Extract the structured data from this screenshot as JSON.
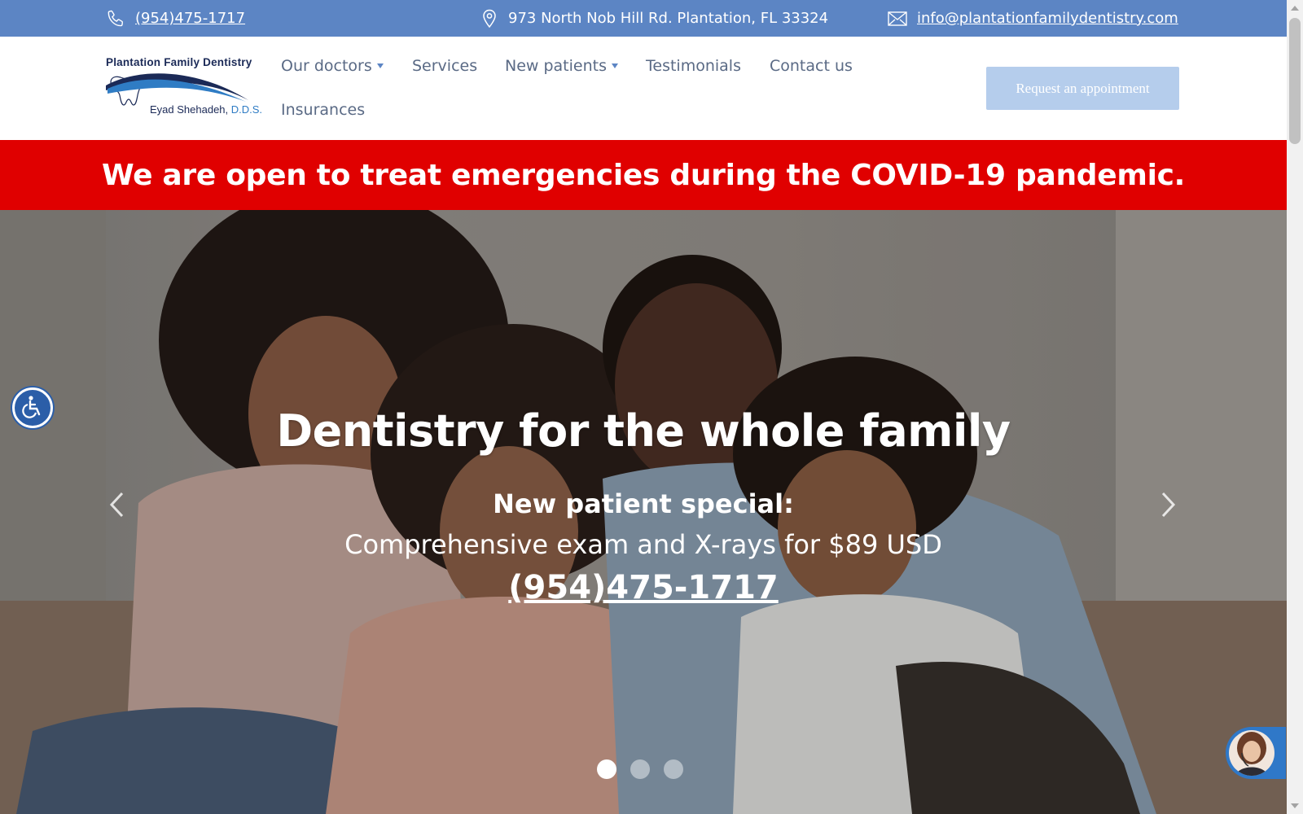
{
  "topbar": {
    "phone": "(954)475-1717",
    "address": "973 North Nob Hill Rd. Plantation, FL 33324",
    "email": "info@plantationfamilydentistry.com",
    "icons": [
      "phone-icon",
      "location-pin-icon",
      "envelope-icon"
    ]
  },
  "logo": {
    "name": "Plantation Family Dentistry",
    "doctor": "Eyad Shehadeh, ",
    "credential": "D.D.S."
  },
  "nav": {
    "items": [
      {
        "label": "Our doctors",
        "dropdown": true
      },
      {
        "label": "Services",
        "dropdown": false
      },
      {
        "label": "New patients",
        "dropdown": true
      },
      {
        "label": "Testimonials",
        "dropdown": false
      },
      {
        "label": "Contact us",
        "dropdown": false
      },
      {
        "label": "Insurances",
        "dropdown": false
      }
    ],
    "cta": "Request an appointment"
  },
  "banner": {
    "text": "We are open to treat emergencies during the COVID-19 pandemic."
  },
  "hero": {
    "title": "Dentistry for the whole family",
    "special": "New patient special:",
    "offer": "Comprehensive exam and X-rays for $89 USD",
    "phone": "(954)475-1717",
    "slides_total": 3,
    "active_slide": 1
  },
  "colors": {
    "topbar": "#5c85c4",
    "banner": "#e00000",
    "cta_bg": "#b5cdec",
    "nav_text": "#5a6a85"
  }
}
